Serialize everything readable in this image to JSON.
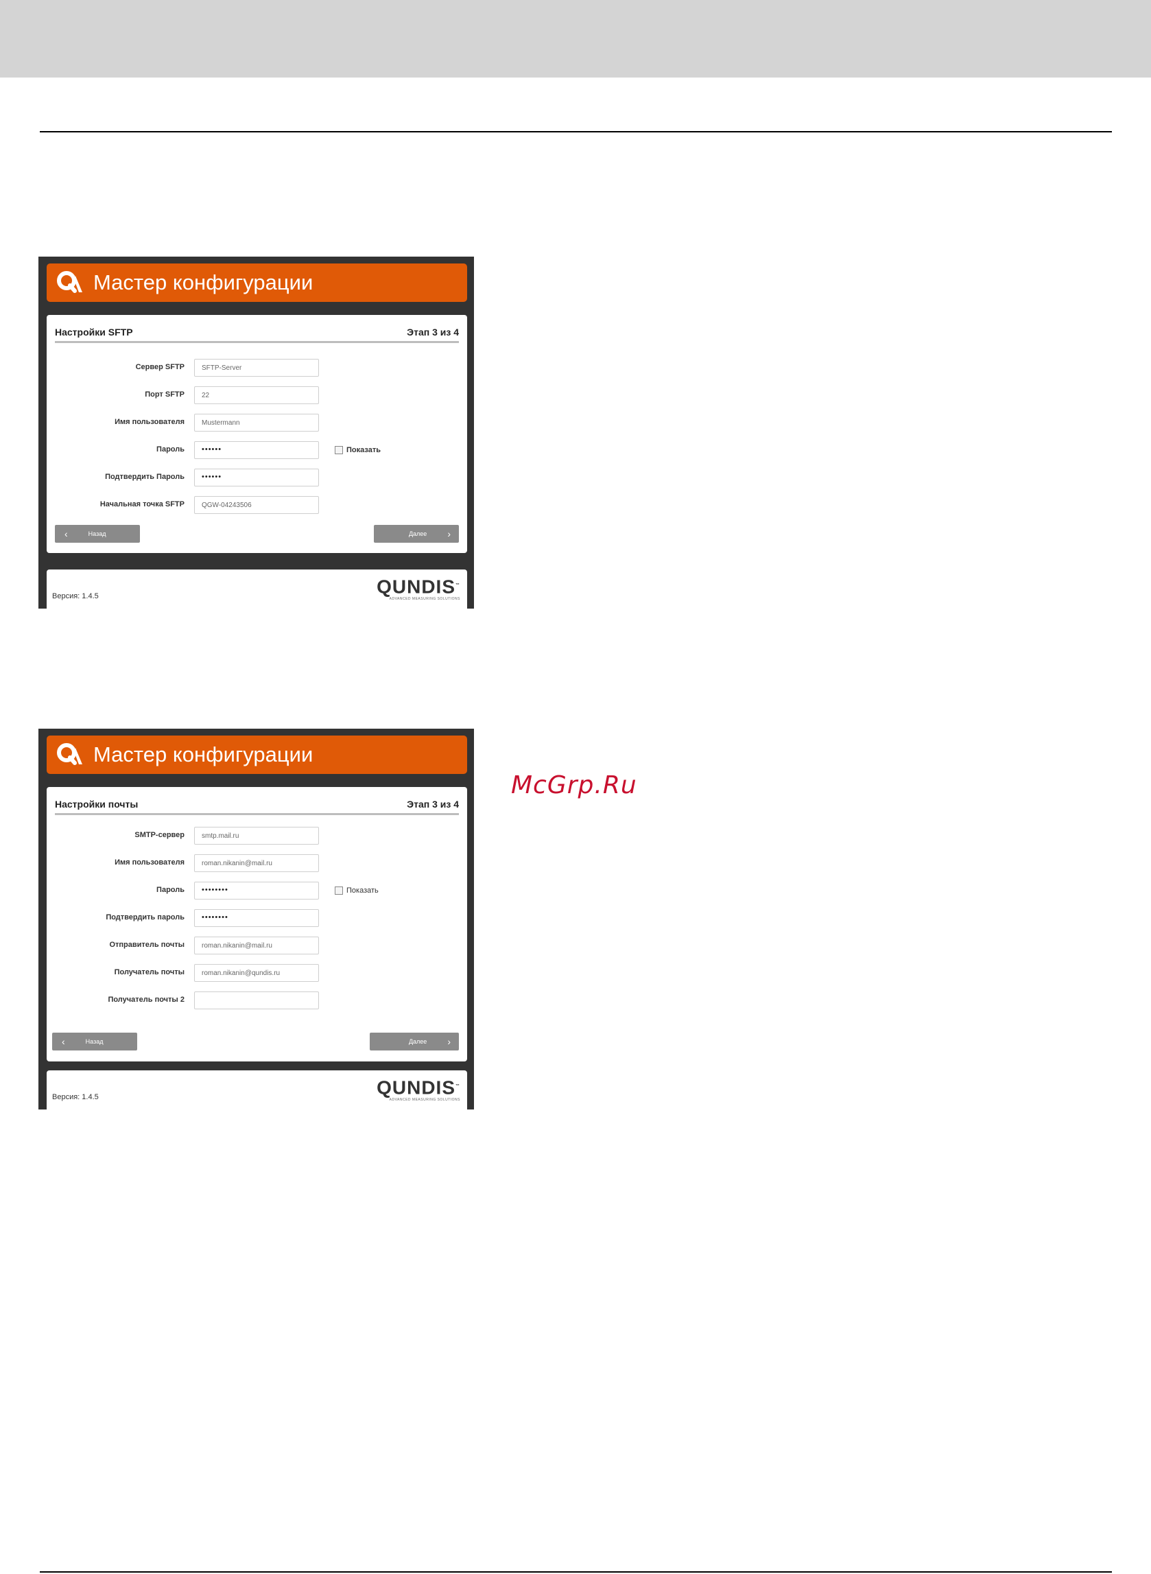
{
  "watermark": "McGrp.Ru",
  "wizards": [
    {
      "title": "Мастер конфигурации",
      "section": "Настройки SFTP",
      "step": "Этап 3 из 4",
      "fields": [
        {
          "label": "Сервер SFTP",
          "value": "SFTP-Server"
        },
        {
          "label": "Порт SFTP",
          "value": "22"
        },
        {
          "label": "Имя пользователя",
          "value": "Mustermann"
        },
        {
          "label": "Пароль",
          "value": "••••••"
        },
        {
          "label": "Подтвердить Пароль",
          "value": "••••••"
        },
        {
          "label": "Начальная точка SFTP",
          "value": "QGW-04243506"
        }
      ],
      "show_label": "Показать",
      "back_label": "Назад",
      "next_label": "Далее",
      "version": "Версия: 1.4.5",
      "brand": "QUNDIS",
      "brand_tm": "™",
      "brand_sub": "ADVANCED MEASURING SOLUTIONS"
    },
    {
      "title": "Мастер конфигурации",
      "section": "Настройки почты",
      "step": "Этап 3 из 4",
      "fields": [
        {
          "label": "SMTP-сервер",
          "value": "smtp.mail.ru"
        },
        {
          "label": "Имя пользователя",
          "value": "roman.nikanin@mail.ru"
        },
        {
          "label": "Пароль",
          "value": "••••••••"
        },
        {
          "label": "Подтвердить пароль",
          "value": "••••••••"
        },
        {
          "label": "Отправитель почты",
          "value": "roman.nikanin@mail.ru"
        },
        {
          "label": "Получатель почты",
          "value": "roman.nikanin@qundis.ru"
        },
        {
          "label": "Получатель почты 2",
          "value": ""
        }
      ],
      "show_label": "Показать",
      "back_label": "Назад",
      "next_label": "Далее",
      "version": "Версия: 1.4.5",
      "brand": "QUNDIS",
      "brand_tm": "™",
      "brand_sub": "ADVANCED MEASURING SOLUTIONS"
    }
  ]
}
